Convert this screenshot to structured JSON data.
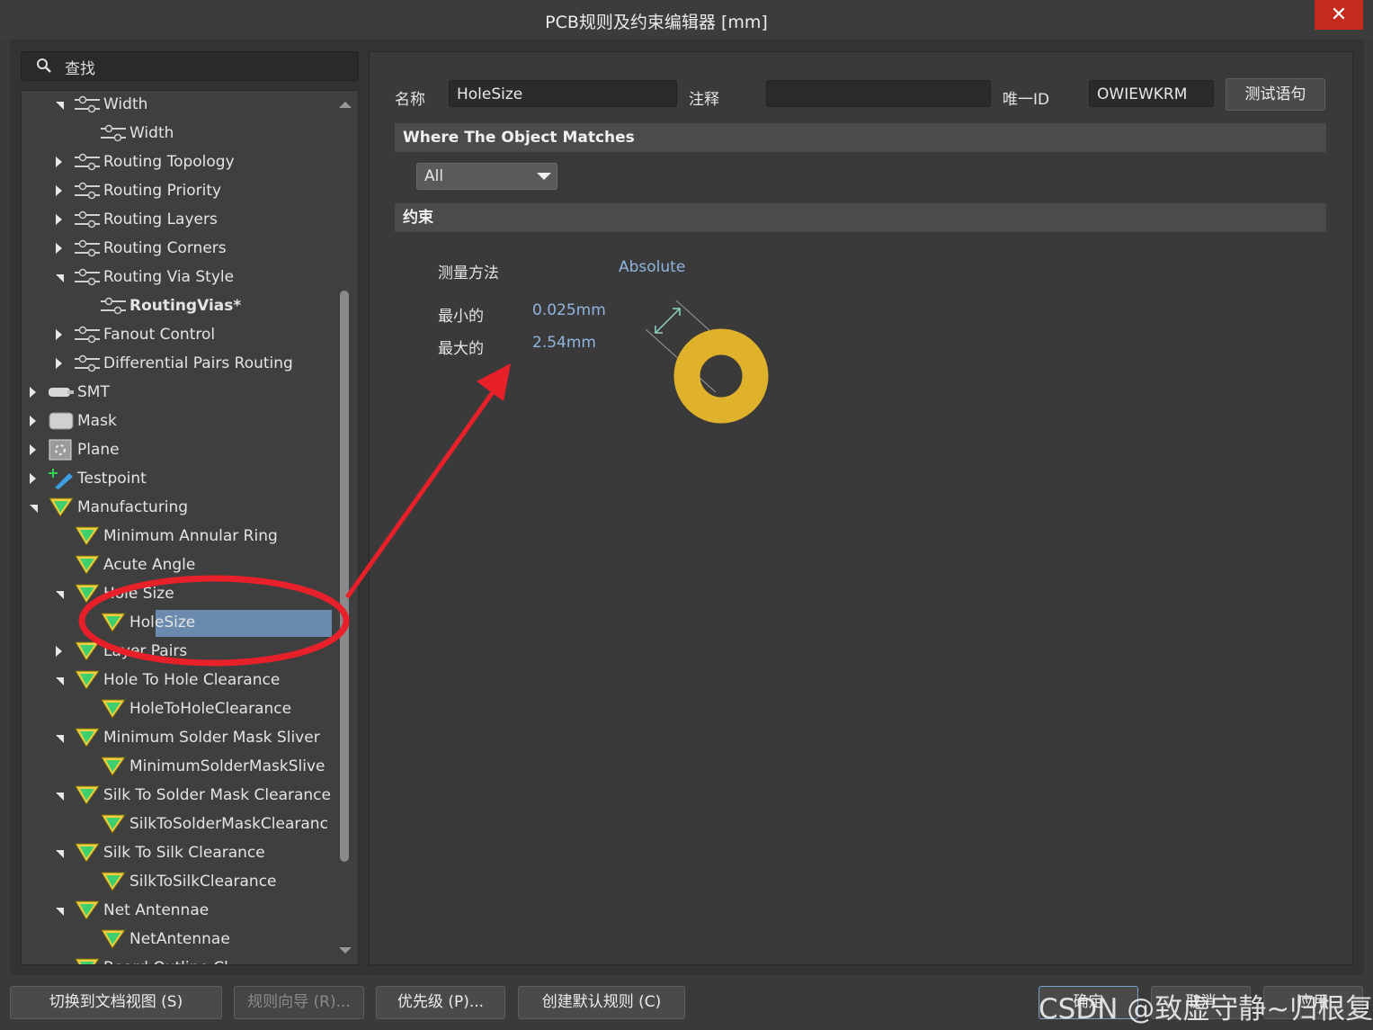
{
  "window": {
    "title": "PCB规则及约束编辑器 [mm]",
    "close_glyph": "✕"
  },
  "search": {
    "label": "查找"
  },
  "tree": [
    {
      "label": "Width",
      "icon": "routing-rule-icon",
      "state": "expanded"
    },
    {
      "label": "Width",
      "icon": "routing-rule-icon",
      "state": "leaf"
    },
    {
      "label": "Routing Topology",
      "icon": "routing-rule-icon",
      "state": "collapsed"
    },
    {
      "label": "Routing Priority",
      "icon": "routing-rule-icon",
      "state": "collapsed"
    },
    {
      "label": "Routing Layers",
      "icon": "routing-rule-icon",
      "state": "collapsed"
    },
    {
      "label": "Routing Corners",
      "icon": "routing-rule-icon",
      "state": "collapsed"
    },
    {
      "label": "Routing Via Style",
      "icon": "routing-rule-icon",
      "state": "expanded"
    },
    {
      "label": "RoutingVias*",
      "icon": "routing-rule-icon",
      "state": "leaf"
    },
    {
      "label": "Fanout Control",
      "icon": "routing-rule-icon",
      "state": "collapsed"
    },
    {
      "label": "Differential Pairs Routing",
      "icon": "routing-rule-icon",
      "state": "collapsed"
    },
    {
      "label": "SMT",
      "icon": "smt-icon",
      "state": "collapsed"
    },
    {
      "label": "Mask",
      "icon": "mask-icon",
      "state": "collapsed"
    },
    {
      "label": "Plane",
      "icon": "plane-icon",
      "state": "collapsed"
    },
    {
      "label": "Testpoint",
      "icon": "testpoint-icon",
      "state": "collapsed"
    },
    {
      "label": "Manufacturing",
      "icon": "manufacturing-icon",
      "state": "expanded"
    },
    {
      "label": "Minimum Annular Ring",
      "icon": "manufacturing-icon",
      "state": "none"
    },
    {
      "label": "Acute Angle",
      "icon": "manufacturing-icon",
      "state": "none"
    },
    {
      "label": "Hole Size",
      "icon": "manufacturing-icon",
      "state": "expanded"
    },
    {
      "label": "HoleSize",
      "icon": "manufacturing-icon",
      "state": "leaf",
      "selected": true
    },
    {
      "label": "Layer Pairs",
      "icon": "manufacturing-icon",
      "state": "collapsed"
    },
    {
      "label": "Hole To Hole Clearance",
      "icon": "manufacturing-icon",
      "state": "expanded"
    },
    {
      "label": "HoleToHoleClearance",
      "icon": "manufacturing-icon",
      "state": "leaf"
    },
    {
      "label": "Minimum Solder Mask Sliver",
      "icon": "manufacturing-icon",
      "state": "expanded"
    },
    {
      "label": "MinimumSolderMaskSlive",
      "icon": "manufacturing-icon",
      "state": "leaf"
    },
    {
      "label": "Silk To Solder Mask Clearance",
      "icon": "manufacturing-icon",
      "state": "expanded"
    },
    {
      "label": "SilkToSolderMaskClearanc",
      "icon": "manufacturing-icon",
      "state": "leaf"
    },
    {
      "label": "Silk To Silk Clearance",
      "icon": "manufacturing-icon",
      "state": "expanded"
    },
    {
      "label": "SilkToSilkClearance",
      "icon": "manufacturing-icon",
      "state": "leaf"
    },
    {
      "label": "Net Antennae",
      "icon": "manufacturing-icon",
      "state": "expanded"
    },
    {
      "label": "NetAntennae",
      "icon": "manufacturing-icon",
      "state": "leaf"
    },
    {
      "label": "Board Outline Cl",
      "icon": "manufacturing-icon",
      "state": "none"
    }
  ],
  "rule": {
    "name_label": "名称",
    "name_value": "HoleSize",
    "comment_label": "注释",
    "comment_value": "",
    "id_label": "唯一ID",
    "id_value": "OWIEWKRM",
    "test_button": "测试语句"
  },
  "where": {
    "header": "Where The Object Matches",
    "scope": "All"
  },
  "constraints": {
    "header": "约束",
    "measure_label": "测量方法",
    "measure_value": "Absolute",
    "min_label": "最小的",
    "min_value": "0.025mm",
    "max_label": "最大的",
    "max_value": "2.54mm",
    "pad_color": "#e0b12a"
  },
  "buttons": {
    "doc_view": "切换到文档视图 (S)",
    "wizard": "规则向导 (R)...",
    "priority": "优先级 (P)...",
    "create_default": "创建默认规则 (C)",
    "ok": "确定",
    "cancel": "取消",
    "apply": "应用"
  },
  "watermark": "CSDN @致虚守静~归根复命",
  "annotation_color": "#e8202a"
}
